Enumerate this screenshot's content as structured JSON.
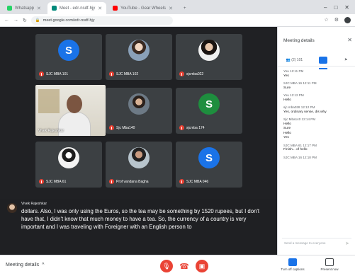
{
  "browser": {
    "tabs": [
      {
        "label": "Whatsapp",
        "favicon_color": "#25d366",
        "active": false
      },
      {
        "label": "Meet - edr-nsdf-hjy",
        "favicon_color": "#00897b",
        "active": true
      },
      {
        "label": "YouTube - Gear Wheels",
        "favicon_color": "#ff0000",
        "active": false
      }
    ],
    "new_tab": "+",
    "url": "meet.google.com/edr-nsdf-hjy",
    "window_controls": [
      "–",
      "□",
      "✕"
    ]
  },
  "participants": [
    {
      "initial": "S",
      "name": "SJC MBA 101",
      "color": "#1a73e8"
    },
    {
      "initial": "",
      "name": "SJC MBA 102",
      "photo": "photo"
    },
    {
      "initial": "",
      "name": "sjcmba022",
      "photo": "photo2"
    },
    {
      "initial": "",
      "name": "Sjc Mba140",
      "photo": "photo3"
    },
    {
      "initial": "S",
      "name": "sjcmba 174",
      "color": "#1e8e3e"
    },
    {
      "initial": "",
      "name": "SJC MBA 61",
      "photo": "photo4"
    },
    {
      "initial": "",
      "name": "Prof vandana Bagha",
      "photo": "photo5"
    },
    {
      "initial": "S",
      "name": "SJC MBA 046",
      "color": "#1a73e8"
    }
  ],
  "pinned": {
    "name": "Vivek Rajeshkar"
  },
  "caption": {
    "speaker": "Vivek Rajeshkar",
    "text": "dollars. Also, I was only using the Euros, so the tea may be something by 1520 rupees, but I don't have that, I didn't know that much money to have a tea. So, the currency of a country is very important and I was traveling with Foreigner with an English person to"
  },
  "bottom": {
    "meeting_details": "Meeting details",
    "mic_icon": "mic-off-icon",
    "cam_icon": "camera-off-icon",
    "turn_on_captions": "Turn off captions",
    "present_now": "Present now"
  },
  "panel": {
    "title": "Meeting details",
    "tabs": [
      "(2) 101",
      "chat",
      "info"
    ],
    "messages": [
      {
        "who": "You 12:11 PM",
        "txt": "Yes"
      },
      {
        "who": "SJC MBA 16 12:11 PM",
        "txt": "Sure"
      },
      {
        "who": "You 12:12 PM",
        "txt": "Hello"
      },
      {
        "who": "sjc mba028 12:12 PM",
        "txt": "Yes, ordinary sense, dis why"
      },
      {
        "who": "Sjc Mba140 12:14 PM",
        "txt": "Hello"
      },
      {
        "who": "",
        "txt": "Sure"
      },
      {
        "who": "",
        "txt": "Hello"
      },
      {
        "who": "",
        "txt": "Yes"
      },
      {
        "who": "SJC MBA 61 12:17 PM",
        "txt": "Finish... of hello"
      },
      {
        "who": "SJC MBA 16 12:18 PM",
        "txt": ""
      }
    ],
    "send_placeholder": "Send a message to everyone"
  }
}
